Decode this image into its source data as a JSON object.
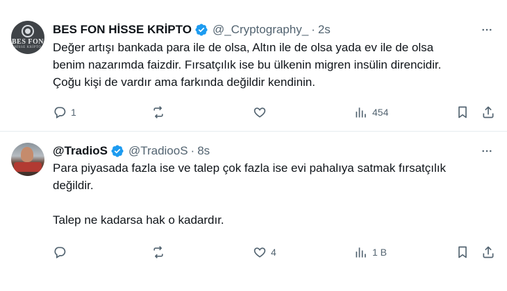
{
  "tweets": [
    {
      "avatar": {
        "line1": "BES FON",
        "line2": "HİSSE KRİPTO"
      },
      "display_name": "BES FON HİSSE KRİPTO",
      "handle": "@_Cryptography_",
      "separator": "·",
      "time": "2s",
      "paragraphs": [
        "Değer artışı bankada para ile de olsa, Altın ile de olsa yada ev ile de olsa\nbenim nazarımda faizdir. Fırsatçılık ise bu ülkenin migren insülin direncidir.\nÇoğu kişi de vardır ama farkında değildir kendinin."
      ],
      "counts": {
        "replies": "1",
        "retweets": "",
        "likes": "",
        "views": "454"
      }
    },
    {
      "display_name": "@TradioS",
      "handle": "@TradiooS",
      "separator": "·",
      "time": "8s",
      "paragraphs": [
        "Para piyasada fazla ise ve talep çok fazla ise evi pahalıya satmak fırsatçılık\ndeğildir.",
        "Talep ne kadarsa hak o kadardır."
      ],
      "counts": {
        "replies": "",
        "retweets": "",
        "likes": "4",
        "views": "1 B"
      }
    }
  ],
  "colors": {
    "verified": "#1d9bf0",
    "secondary_text": "#536471",
    "primary_text": "#0f1419",
    "divider": "#e6ecf0"
  },
  "icons": [
    "verified-badge-icon",
    "more-icon",
    "reply-icon",
    "retweet-icon",
    "like-icon",
    "views-icon",
    "bookmark-icon",
    "share-icon"
  ]
}
